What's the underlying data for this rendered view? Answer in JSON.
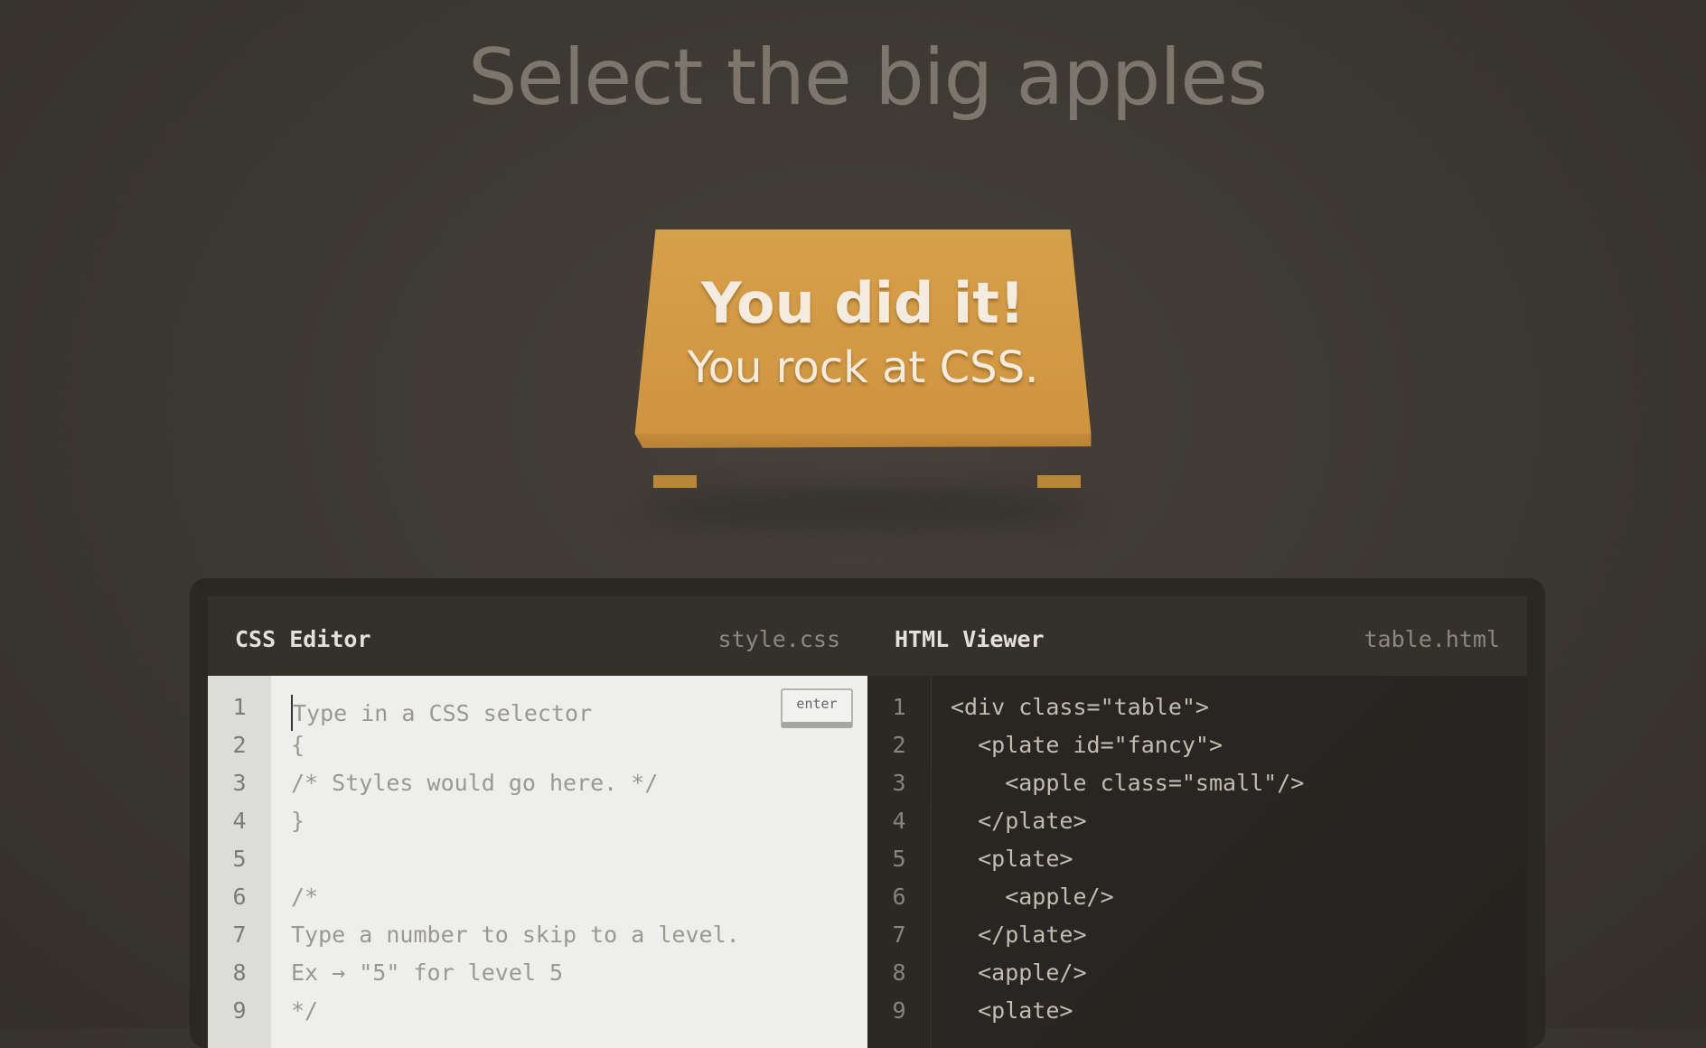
{
  "header": {
    "level_title": "Select the big apples"
  },
  "table": {
    "win_line_1": "You did it!",
    "win_line_2": "You rock at CSS."
  },
  "css_editor": {
    "title": "CSS Editor",
    "filename": "style.css",
    "input_placeholder": "Type in a CSS selector",
    "enter_label": "enter",
    "line_numbers": [
      "1",
      "2",
      "3",
      "4",
      "5",
      "6",
      "7",
      "8",
      "9"
    ],
    "lines": [
      "{",
      "/* Styles would go here. */",
      "}",
      "",
      "/*",
      "Type a number to skip to a level.",
      "Ex → \"5\" for level 5",
      "*/"
    ]
  },
  "html_viewer": {
    "title": "HTML Viewer",
    "filename": "table.html",
    "line_numbers": [
      "1",
      "2",
      "3",
      "4",
      "5",
      "6",
      "7",
      "8",
      "9"
    ],
    "lines": [
      "<div class=\"table\">",
      "  <plate id=\"fancy\">",
      "    <apple class=\"small\"/>",
      "  </plate>",
      "  <plate>",
      "    <apple/>",
      "  </plate>",
      "  <apple/>",
      "  <plate>"
    ]
  },
  "colors": {
    "background": "#3e3a34",
    "table": "#d19a45",
    "title_text": "#7c766c"
  }
}
